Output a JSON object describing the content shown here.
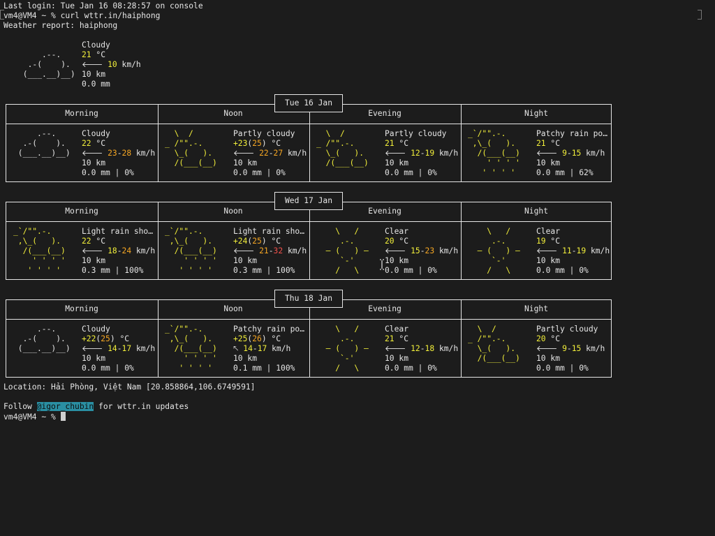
{
  "terminal": {
    "last_login": "Last login: Tue Jan 16 08:28:57 on console",
    "prompt_cmd": "vm4@VM4 ~ % curl wttr.in/haiphong",
    "report_title": "Weather report: haiphong",
    "location": "Location: Hải Phòng, Việt Nam [20.858864,106.6749591]",
    "follow_prefix": "Follow ",
    "follow_handle": "@igor_chubin",
    "follow_suffix": " for wttr.in updates",
    "final_prompt": "vm4@VM4 ~ % "
  },
  "current": {
    "condition": "Cloudy",
    "temp": "21",
    "temp_unit": " °C",
    "wind_arrow": "🡐",
    "wind": "10",
    "wind_unit": " km/h",
    "visibility": "10 km",
    "precip": "0.0 mm",
    "art": "     .--.    \n  .-(    ).  \n (___.__)__) "
  },
  "periods": [
    "Morning",
    "Noon",
    "Evening",
    "Night"
  ],
  "days": [
    {
      "label": "Tue 16 Jan",
      "cells": [
        {
          "art": "     .--.    \n  .-(    ).  \n (___.__)__) ",
          "condition": "Cloudy",
          "temp": [
            {
              "t": "22",
              "c": "yellow"
            }
          ],
          "arrow": "🡐",
          "wind": [
            {
              "t": "23",
              "c": "orange"
            },
            {
              "t": "-",
              "c": "white"
            },
            {
              "t": "28",
              "c": "orange"
            }
          ],
          "vis": "10 km",
          "precip": "0.0 mm | 0%"
        },
        {
          "art": "  \\  /       \n_ /\"\".-.     \n  \\_(   ).   \n  /(___(__)  ",
          "condition": "Partly cloudy",
          "temp": [
            {
              "t": "+23",
              "c": "yellow"
            },
            {
              "t": "(",
              "c": "white"
            },
            {
              "t": "25",
              "c": "orange"
            },
            {
              "t": ")",
              "c": "white"
            }
          ],
          "arrow": "🡐",
          "wind": [
            {
              "t": "22",
              "c": "orange"
            },
            {
              "t": "-",
              "c": "white"
            },
            {
              "t": "27",
              "c": "orange"
            }
          ],
          "vis": "10 km",
          "precip": "0.0 mm | 0%"
        },
        {
          "art": "  \\  /       \n_ /\"\".-.     \n  \\_(   ).   \n  /(___(__)  ",
          "condition": "Partly cloudy",
          "temp": [
            {
              "t": "21",
              "c": "yellow"
            }
          ],
          "arrow": "🡐",
          "wind": [
            {
              "t": "12",
              "c": "yellow"
            },
            {
              "t": "-",
              "c": "white"
            },
            {
              "t": "19",
              "c": "yellow"
            }
          ],
          "vis": "10 km",
          "precip": "0.0 mm | 0%"
        },
        {
          "art": "_`/\"\".-.     \n ,\\_(   ).   \n  /(___(__)  \n    ' ' ' '  \n   ' ' ' '   ",
          "condition": "Patchy rain po…",
          "temp": [
            {
              "t": "21",
              "c": "yellow"
            }
          ],
          "arrow": "🡐",
          "wind": [
            {
              "t": "9",
              "c": "yellow"
            },
            {
              "t": "-",
              "c": "white"
            },
            {
              "t": "15",
              "c": "yellow"
            }
          ],
          "vis": "10 km",
          "precip": "0.0 mm | 62%"
        }
      ]
    },
    {
      "label": "Wed 17 Jan",
      "cells": [
        {
          "art": "_`/\"\".-.     \n ,\\_(   ).   \n  /(___(__)  \n    ' ' ' '  \n   ' ' ' '   ",
          "condition": "Light rain sho…",
          "temp": [
            {
              "t": "22",
              "c": "yellow"
            }
          ],
          "arrow": "🡐",
          "wind": [
            {
              "t": "18",
              "c": "yellow"
            },
            {
              "t": "-",
              "c": "white"
            },
            {
              "t": "24",
              "c": "orange"
            }
          ],
          "vis": "10 km",
          "precip": "0.3 mm | 100%"
        },
        {
          "art": "_`/\"\".-.     \n ,\\_(   ).   \n  /(___(__)  \n    ' ' ' '  \n   ' ' ' '   ",
          "condition": "Light rain sho…",
          "temp": [
            {
              "t": "+24",
              "c": "yellow"
            },
            {
              "t": "(",
              "c": "white"
            },
            {
              "t": "25",
              "c": "orange"
            },
            {
              "t": ")",
              "c": "white"
            }
          ],
          "arrow": "🡐",
          "wind": [
            {
              "t": "21",
              "c": "orange"
            },
            {
              "t": "-",
              "c": "white"
            },
            {
              "t": "32",
              "c": "red"
            }
          ],
          "vis": "10 km",
          "precip": "0.3 mm | 100%"
        },
        {
          "art": "    \\   /    \n     .-.     \n  ― (   ) ―  \n     `-'     \n    /   \\    ",
          "condition": "Clear",
          "temp": [
            {
              "t": "20",
              "c": "yellow"
            }
          ],
          "arrow": "🡐",
          "wind": [
            {
              "t": "15",
              "c": "yellow"
            },
            {
              "t": "-",
              "c": "white"
            },
            {
              "t": "23",
              "c": "orange"
            }
          ],
          "vis": "10 km",
          "precip": "0.0 mm | 0%"
        },
        {
          "art": "    \\   /    \n     .-.     \n  ― (   ) ―  \n     `-'     \n    /   \\    ",
          "condition": "Clear",
          "temp": [
            {
              "t": "19",
              "c": "yellow"
            }
          ],
          "arrow": "🡐",
          "wind": [
            {
              "t": "11",
              "c": "yellow"
            },
            {
              "t": "-",
              "c": "white"
            },
            {
              "t": "19",
              "c": "yellow"
            }
          ],
          "vis": "10 km",
          "precip": "0.0 mm | 0%"
        }
      ]
    },
    {
      "label": "Thu 18 Jan",
      "cells": [
        {
          "art": "     .--.    \n  .-(    ).  \n (___.__)__) ",
          "condition": "Cloudy",
          "temp": [
            {
              "t": "+22",
              "c": "yellow"
            },
            {
              "t": "(",
              "c": "white"
            },
            {
              "t": "25",
              "c": "orange"
            },
            {
              "t": ")",
              "c": "white"
            }
          ],
          "arrow": "🡐",
          "wind": [
            {
              "t": "14",
              "c": "yellow"
            },
            {
              "t": "-",
              "c": "white"
            },
            {
              "t": "17",
              "c": "yellow"
            }
          ],
          "vis": "10 km",
          "precip": "0.0 mm | 0%"
        },
        {
          "art": "_`/\"\".-.     \n ,\\_(   ).   \n  /(___(__)  \n    ' ' ' '  \n   ' ' ' '   ",
          "condition": "Patchy rain po…",
          "temp": [
            {
              "t": "+25",
              "c": "yellow"
            },
            {
              "t": "(",
              "c": "white"
            },
            {
              "t": "26",
              "c": "orange"
            },
            {
              "t": ")",
              "c": "white"
            }
          ],
          "arrow": "🡔",
          "wind": [
            {
              "t": "14",
              "c": "yellow"
            },
            {
              "t": "-",
              "c": "white"
            },
            {
              "t": "17",
              "c": "yellow"
            }
          ],
          "vis": "10 km",
          "precip": "0.1 mm | 100%"
        },
        {
          "art": "    \\   /    \n     .-.     \n  ― (   ) ―  \n     `-'     \n    /   \\    ",
          "condition": "Clear",
          "temp": [
            {
              "t": "21",
              "c": "yellow"
            }
          ],
          "arrow": "🡐",
          "wind": [
            {
              "t": "12",
              "c": "yellow"
            },
            {
              "t": "-",
              "c": "white"
            },
            {
              "t": "18",
              "c": "yellow"
            }
          ],
          "vis": "10 km",
          "precip": "0.0 mm | 0%"
        },
        {
          "art": "  \\  /       \n_ /\"\".-.     \n  \\_(   ).   \n  /(___(__)  ",
          "condition": "Partly cloudy",
          "temp": [
            {
              "t": "20",
              "c": "yellow"
            }
          ],
          "arrow": "🡐",
          "wind": [
            {
              "t": "9",
              "c": "yellow"
            },
            {
              "t": "-",
              "c": "white"
            },
            {
              "t": "15",
              "c": "yellow"
            }
          ],
          "vis": "10 km",
          "precip": "0.0 mm | 0%"
        }
      ]
    }
  ],
  "colors": {
    "background": "#1c1c1c",
    "foreground": "#e6e6e6",
    "yellow": "#f2ef3a",
    "orange": "#f5a623",
    "red": "#f0504b",
    "link_highlight": "#2a8fa3"
  }
}
